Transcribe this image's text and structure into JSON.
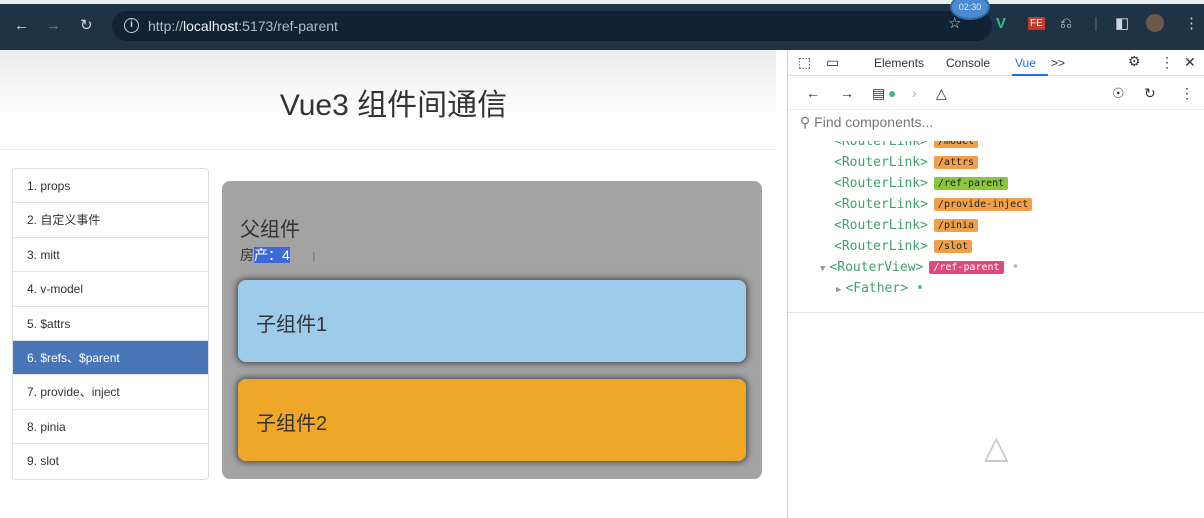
{
  "browser": {
    "url_prefix": "http://",
    "url_host": "localhost",
    "url_rest": ":5173/ref-parent",
    "timer": "02:30"
  },
  "page": {
    "title": "Vue3 组件间通信",
    "nav": [
      "1. props",
      "2. 自定义事件",
      "3. mitt",
      "4. v-model",
      "5. $attrs",
      "6. $refs、$parent",
      "7. provide、inject",
      "8. pinia",
      "9. slot"
    ],
    "active_nav_index": 5,
    "father": {
      "title": "父组件",
      "house_prefix": "房",
      "house_selected": "产：4",
      "child1": "子组件1",
      "child2": "子组件2"
    }
  },
  "devtools": {
    "tabs": [
      "Elements",
      "Console",
      "Vue"
    ],
    "more": ">>",
    "active_tab": "Vue",
    "search_placeholder": "Find components...",
    "tree": [
      {
        "name": "<RouterLink>",
        "tag": "/model",
        "color": "orange"
      },
      {
        "name": "<RouterLink>",
        "tag": "/attrs",
        "color": "orange"
      },
      {
        "name": "<RouterLink>",
        "tag": "/ref-parent",
        "color": "green"
      },
      {
        "name": "<RouterLink>",
        "tag": "/provide-inject",
        "color": "orange"
      },
      {
        "name": "<RouterLink>",
        "tag": "/pinia",
        "color": "orange"
      },
      {
        "name": "<RouterLink>",
        "tag": "/slot",
        "color": "orange"
      },
      {
        "name": "<RouterView>",
        "tag": "/ref-parent",
        "color": "pink"
      },
      {
        "name": "<Father>",
        "tag": "",
        "color": ""
      }
    ]
  }
}
